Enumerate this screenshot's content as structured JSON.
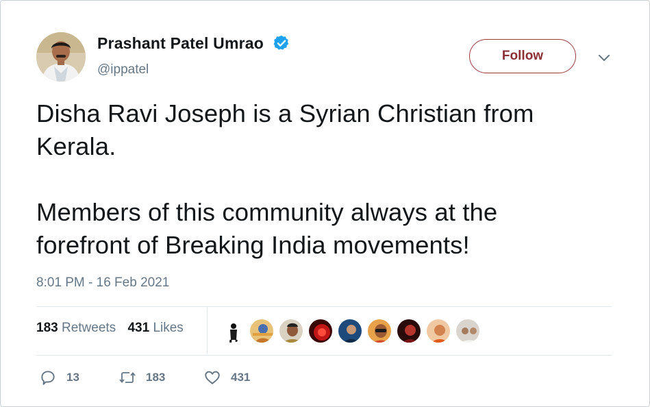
{
  "author": {
    "name": "Prashant Patel Umrao",
    "handle": "@ippatel",
    "verified": true
  },
  "follow_button": {
    "label": "Follow"
  },
  "tweet": {
    "text": "Disha Ravi Joseph is a Syrian Christian from\nKerala.\n\nMembers of this community always at the\nforefront of Breaking India movements!",
    "timestamp": "8:01 PM - 16 Feb 2021"
  },
  "stats": {
    "retweets_count": "183",
    "retweets_label": "Retweets",
    "likes_count": "431",
    "likes_label": "Likes"
  },
  "actions": {
    "reply_count": "13",
    "retweet_count": "183",
    "like_count": "431"
  },
  "colors": {
    "verified_blue": "#1da1f2",
    "follow_border": "#9c3a3f",
    "secondary_text": "#657786"
  }
}
